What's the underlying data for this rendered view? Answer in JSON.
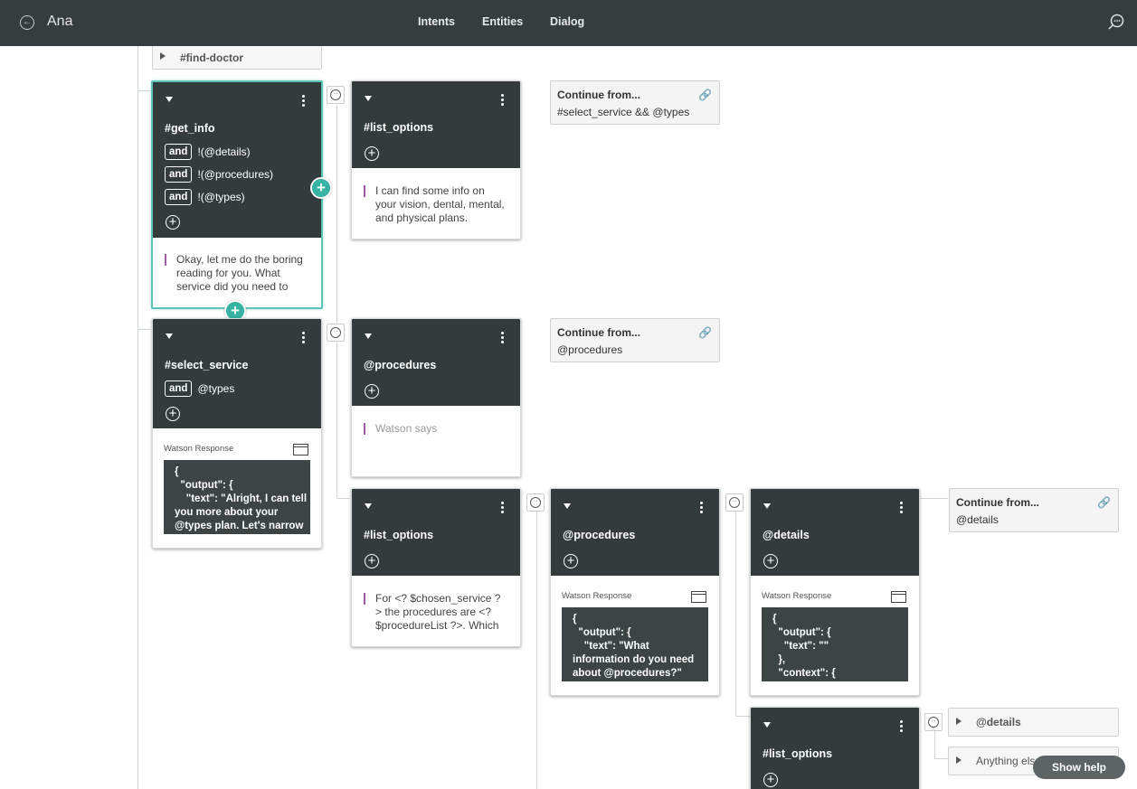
{
  "header": {
    "app_name": "Ana",
    "tabs": [
      {
        "label": "Intents"
      },
      {
        "label": "Entities"
      },
      {
        "label": "Dialog"
      }
    ]
  },
  "nodes": {
    "find_doctor": {
      "label": "#find-doctor"
    },
    "get_info": {
      "condition": "#get_info",
      "and_conditions": [
        {
          "op": "and",
          "text": "!(@details)"
        },
        {
          "op": "and",
          "text": "!(@procedures)"
        },
        {
          "op": "and",
          "text": "!(@types)"
        }
      ],
      "response": "Okay, let me do the boring reading for you. What service did you need to"
    },
    "list_options_1": {
      "condition": "#list_options",
      "response": "I can find some info on your vision, dental, mental, and physical plans."
    },
    "continue_1": {
      "title": "Continue from...",
      "target": "#select_service && @types"
    },
    "select_service": {
      "condition": "#select_service",
      "and_conditions": [
        {
          "op": "and",
          "text": "@types"
        }
      ],
      "response_label": "Watson Response",
      "json": "{\n  \"output\": {\n    \"text\": \"Alright, I can tell\nyou more about your\n@types plan. Let's narrow"
    },
    "procedures_1": {
      "condition": "@procedures",
      "response": "Watson says"
    },
    "continue_2": {
      "title": "Continue from...",
      "target": "@procedures"
    },
    "list_options_2": {
      "condition": "#list_options",
      "response": "For <? $chosen_service ? > the procedures are <? $procedureList ?>. Which"
    },
    "procedures_2": {
      "condition": "@procedures",
      "response_label": "Watson Response",
      "json": "{\n  \"output\": {\n    \"text\": \"What\ninformation do you need\nabout @procedures?\""
    },
    "details": {
      "condition": "@details",
      "response_label": "Watson Response",
      "json": "{\n  \"output\": {\n    \"text\": \"\"\n  },\n  \"context\": {"
    },
    "continue_3": {
      "title": "Continue from...",
      "target": "@details"
    },
    "list_options_3": {
      "condition": "#list_options"
    },
    "collapsed_details": {
      "label": "@details"
    },
    "collapsed_anything": {
      "label": "Anything else"
    }
  },
  "show_help": "Show help",
  "colors": {
    "topbar": "#363d3f",
    "node_dark": "#343b3d",
    "accent_teal": "#36b3a3",
    "response_bar": "#9c5ea3"
  }
}
